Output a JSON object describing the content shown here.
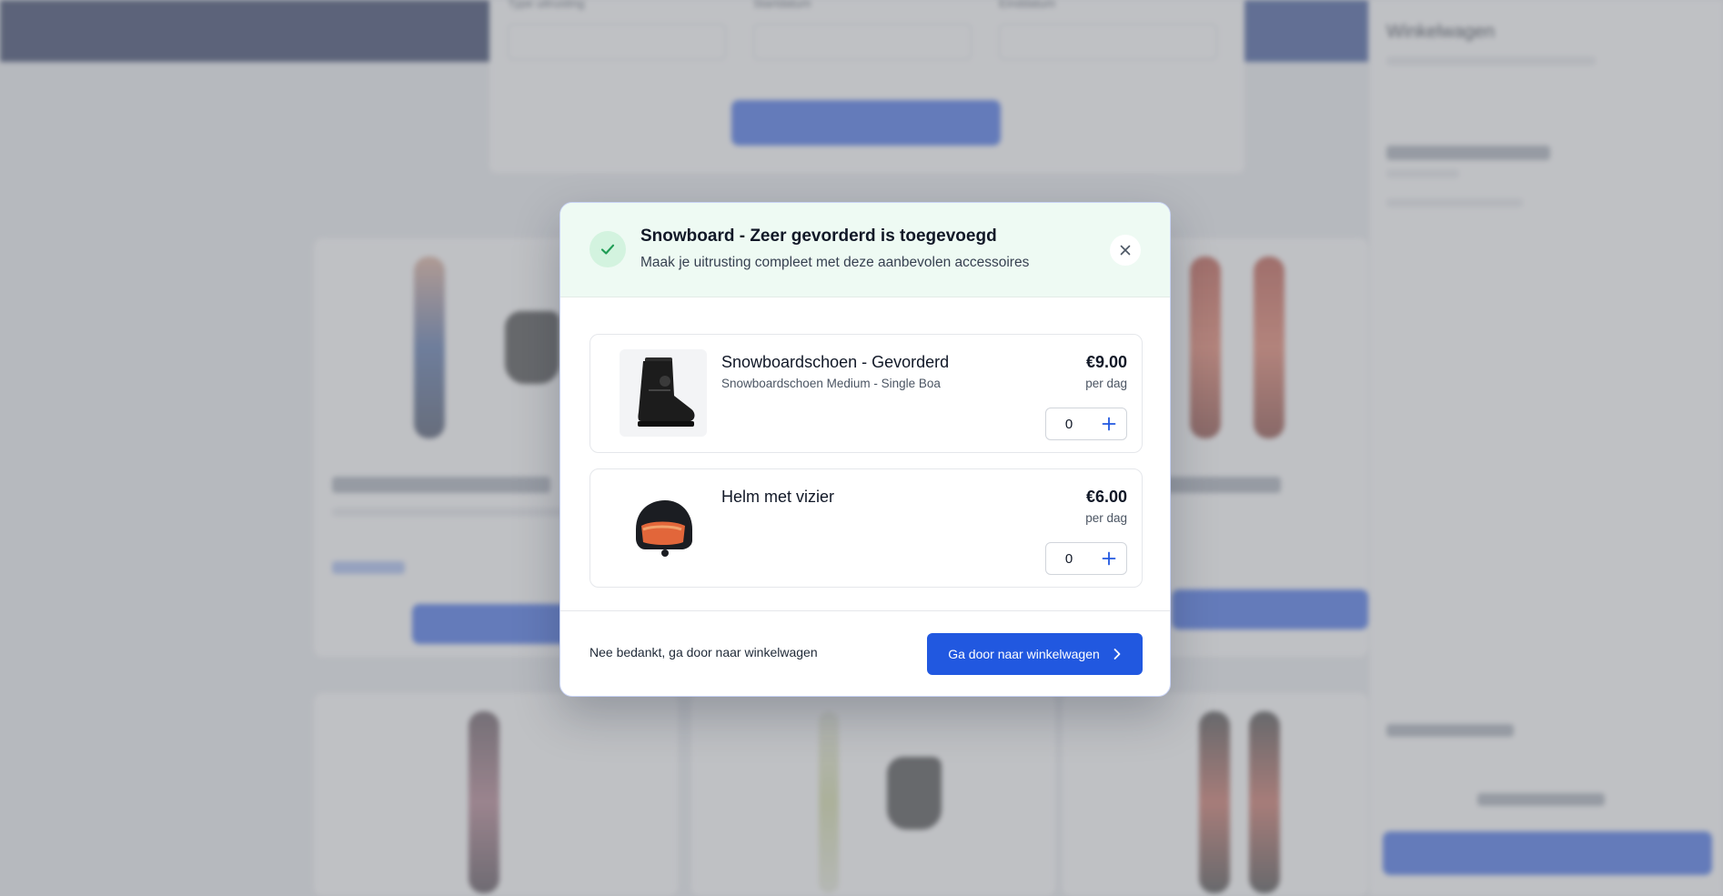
{
  "background": {
    "search_labels": [
      "Type uitrusting",
      "Startdatum",
      "Einddatum"
    ],
    "panel_title": "Winkelwagen"
  },
  "modal": {
    "title": "Snowboard - Zeer gevorderd is toegevoegd",
    "subtitle": "Maak je uitrusting compleet met deze aanbevolen accessoires",
    "close_icon": "close-icon",
    "success_icon": "check-icon",
    "accent_color": "#2158e0",
    "success_color": "#1f9d55"
  },
  "accessories": [
    {
      "name": "Snowboardschoen - Gevorderd",
      "description": "Snowboardschoen Medium - Single Boa",
      "price": "€9.00",
      "unit": "per dag",
      "quantity": "0",
      "image_icon": "snowboard-boot-icon"
    },
    {
      "name": "Helm met vizier",
      "description": "",
      "price": "€6.00",
      "unit": "per dag",
      "quantity": "0",
      "image_icon": "helmet-icon"
    }
  ],
  "footer": {
    "skip_label": "Nee bedankt, ga door naar winkelwagen",
    "continue_label": "Ga door naar winkelwagen",
    "continue_icon": "chevron-right-icon"
  }
}
